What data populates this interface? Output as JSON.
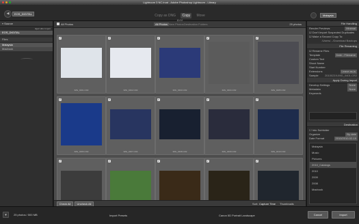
{
  "window": {
    "title": "Lightroom 3 NC.lrcat - Adobe Photoshop Lightroom - Library"
  },
  "header": {
    "source_label": "EOS_DIGITAL",
    "modes": [
      {
        "label": "Copy as DNG",
        "active": false
      },
      {
        "label": "Copy",
        "active": true
      },
      {
        "label": "Move",
        "active": false
      },
      {
        "label": "Add",
        "active": false
      }
    ],
    "destination_label": "Malaysia"
  },
  "left_panel": {
    "title": "Source",
    "eject_label": "Eject after import",
    "device": "EOS_DIGITAL",
    "files": [
      "Files"
    ],
    "folders": [
      "Malaysia",
      "Macbook"
    ]
  },
  "grid": {
    "filter_label": "All Photos",
    "view_tabs": [
      "All Photos",
      "New Photos",
      "Destination Folders"
    ],
    "count": "25 photos",
    "photos": [
      {
        "name": "IMG_0401.CR2",
        "color": "#dfe4ea",
        "shape": "land"
      },
      {
        "name": "IMG_0402.CR2",
        "color": "#e6e9ef",
        "shape": "land"
      },
      {
        "name": "IMG_0403.CR2",
        "color": "#2b3a78",
        "shape": "land"
      },
      {
        "name": "IMG_0404.CR2",
        "color": "#5b5b5b",
        "shape": "port"
      },
      {
        "name": "IMG_0405.CR2",
        "color": "#4c4c52",
        "shape": "port"
      },
      {
        "name": "IMG_0406.CR2",
        "color": "#1a3a8a",
        "shape": "port"
      },
      {
        "name": "IMG_0407.CR2",
        "color": "#283560",
        "shape": "land"
      },
      {
        "name": "IMG_0408.CR2",
        "color": "#182030",
        "shape": "land"
      },
      {
        "name": "IMG_0409.CR2",
        "color": "#2a2c3c",
        "shape": "land"
      },
      {
        "name": "IMG_0410.CR2",
        "color": "#1e2c4c",
        "shape": "land"
      },
      {
        "name": "IMG_0411.CR2",
        "color": "#3c3c3c",
        "shape": "land"
      },
      {
        "name": "IMG_0412.CR2",
        "color": "#4a7a3a",
        "shape": "land"
      },
      {
        "name": "IMG_0413.CR2",
        "color": "#3a2a18",
        "shape": "land"
      },
      {
        "name": "IMG_0414.CR2",
        "color": "#2a2418",
        "shape": "land"
      },
      {
        "name": "IMG_0415.CR2",
        "color": "#20262e",
        "shape": "land"
      }
    ]
  },
  "bottom": {
    "check_all": "Check All",
    "uncheck_all": "Uncheck All",
    "sort_label": "Sort:",
    "sort_value": "Capture Time",
    "thumbnails_label": "Thumbnails"
  },
  "right_panel": {
    "file_handling": "File Handling",
    "render_previews": "Render Previews",
    "render_value": "Minimal",
    "dont_import_dupes": "Don't Import Suspected Duplicates",
    "make_second_copy": "Make a Second Copy To:",
    "second_copy_path": "/Users/.../Download Backups",
    "file_renaming": "File Renaming",
    "rename_files": "Rename Files",
    "template": "Template",
    "template_value": "Date - Filename",
    "custom_text": "Custom Text",
    "shoot_name": "Shoot Name",
    "start_number": "Start Number",
    "extensions": "Extensions",
    "extensions_value": "Leave as-is",
    "sample": "Sample",
    "sample_value": "20100219-IMG_0401.CR2",
    "apply_during_import": "Apply During Import",
    "develop_settings": "Develop Settings",
    "develop_value": "None",
    "metadata": "Metadata",
    "metadata_value": "None",
    "keywords": "Keywords",
    "destination": "Destination",
    "into_subfolder": "Into Subfolder",
    "organize": "Organize",
    "organize_value": "By date",
    "date_format": "Date Format",
    "date_format_value": "2010/2010-02-19",
    "dest_items": [
      "Malaysia",
      "Music",
      "Pictures",
      "2010_Catalogs",
      "2010",
      "2009",
      "2008",
      "Macbook"
    ]
  },
  "footer": {
    "preset_label": "Import Preset:",
    "preset_value": "None",
    "summary": "25 photos / 500 MB",
    "import_btn": "Import",
    "cancel_btn": "Cancel",
    "import_presets_left": "Import Presets",
    "import_presets_right": "Canon 5D Portrait Landscape"
  }
}
